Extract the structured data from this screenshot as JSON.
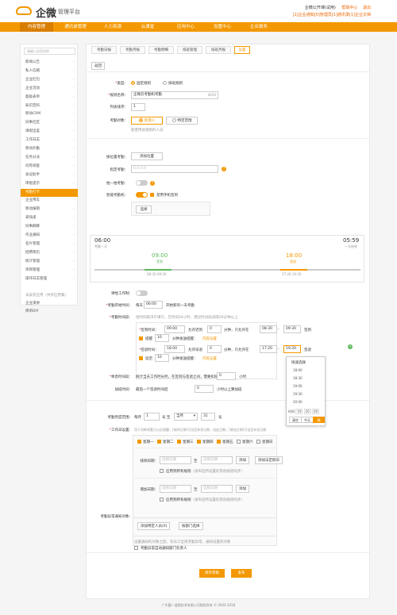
{
  "header": {
    "logo": "企微",
    "subtitle": "管理平台",
    "company": "企微公开课(试用)",
    "badge": "试用",
    "help": "帮助中心",
    "logout": "退出",
    "notice": "[1]企业通知[0]管理员[1]通讯录[1]企业文档"
  },
  "nav": [
    "内容管理",
    "通讯录管理",
    "人力资源",
    "云课堂",
    "应用中心",
    "设置中心",
    "企业服务"
  ],
  "sidebar": {
    "search_placeholder": "请输入应用名称",
    "items": [
      "新闻公告",
      "私人信箱",
      "企业红包",
      "企业活动",
      "超级表单",
      "知识百科",
      "移动CRM",
      "同事社区",
      "请假出差",
      "工作日志",
      "移动外勤",
      "任务分派",
      "问卷调查",
      "会议助手",
      "审批提示",
      "考勤打卡",
      "企业用车",
      "移动报销",
      "拿快递",
      "同事群聊",
      "作业通知",
      "名片管理",
      "招聘简历",
      "统计管理",
      "项目管理",
      "操作日志管理"
    ],
    "active_index": 15,
    "section": "未安装应用（共享应用集）",
    "extra": [
      "企业演讲",
      "简单DIY"
    ]
  },
  "tabs": [
    "考勤日报",
    "考勤月报",
    "考勤明细",
    "排班管理",
    "排班月报",
    "设置"
  ],
  "active_tab": 5,
  "back_btn": "返回",
  "form": {
    "type_label": "类型：",
    "type_fixed": "固定规则",
    "type_shift": "排班规则",
    "name_label": "规则名称：",
    "name_value": "企微云考勤机考勤",
    "name_count": "8/20",
    "order_label": "列表排序：",
    "order_value": "1",
    "target_label": "考勤对象：",
    "target_add": "新增人",
    "target_special": "特定范围",
    "target_hint": "能使用此规则的人员",
    "loc_label": "按位置考勤：",
    "loc_btn": "添加位置",
    "wifi_label": "指定考勤：",
    "wifi_ph": "0.0.0.0",
    "scan_label": "拍一拍考勤：",
    "machine_label": "智能考勤机：",
    "machine_check": "禁用手机签到",
    "select_btn": "选择"
  },
  "timeline": {
    "start": "06:00",
    "start_sub": "考勤一天",
    "end": "05:59",
    "end_sub": "一天结束",
    "t1": "09:00",
    "t1_sub": "签到",
    "t2": "18:00",
    "t2_sub": "签退",
    "r1": "08:30-09:30",
    "r2": "17:20-19:20"
  },
  "shift": {
    "flex_label": "弹性工作制：",
    "start_label": "考勤开始时间：",
    "start_pre": "每天",
    "start_val": "06:00",
    "start_post": "开始新的一天考勤",
    "time_label": "考勤时间段：",
    "time_hint": "指时间取决于填写，在时间24小时，建议时间段间隔30分钟以上",
    "in_label": "签到时间：",
    "in_time": "09:00",
    "late": "允许迟到",
    "late_v": "0",
    "late_unit": "分钟，只允许在",
    "in_from": "08:30",
    "in_to": "09:30",
    "in_act": "签到",
    "remind": "提醒",
    "remind_v": "10",
    "remind_unit": "分钟发送提醒：",
    "remind_set": "内容设置",
    "out_label": "签退时间：",
    "out_time": "18:00",
    "early": "允许早退",
    "early_v": "0",
    "out_from": "17:20",
    "out_to": "19:20",
    "out_act": "签退",
    "delay": "延迟",
    "delay_v": "10",
    "rest_label": "休息时间段：",
    "rest_text": "统计当天工作时长时，在签到与签退之间，需要扣除",
    "rest_v": "0",
    "rest_unit": "小时",
    "ot_label": "加班时间：",
    "ot_text": "最后一个签退时间后",
    "ot_v": "0",
    "ot_unit": "小时以上算加班"
  },
  "picker": {
    "title": "快速选择",
    "items": [
      "18:00",
      "18:30",
      "19:00",
      "19:30",
      "20:00"
    ],
    "label": "时间",
    "h": "19",
    "m": "20",
    "s": "00",
    "clear": "清空",
    "now": "今天",
    "ok": "确定"
  },
  "month": {
    "label": "考勤月度范围：",
    "pre": "每月",
    "d1": "1",
    "mid": "号 至",
    "sel": "当月",
    "d2": "31",
    "post": "号"
  },
  "workday": {
    "label": "工作日设置：",
    "hint": "用于判断考勤日以反提醒，[排除日期]可设定休息日期，由此日期，[增加日期]可设定补班日期",
    "days": [
      "星期一",
      "星期二",
      "星期三",
      "星期四",
      "星期五",
      "星期六",
      "星期日"
    ],
    "checked": [
      true,
      true,
      true,
      true,
      true,
      false,
      false
    ],
    "ex_label": "排除日期：",
    "ex_ph": "选择日期",
    "to": "至",
    "add": "添加",
    "add_holiday": "添加法定假日",
    "apply": "应用到所有规则",
    "apply_hint": "（发布后所设置的其他规则同步）",
    "inc_label": "增加日期："
  },
  "notify": {
    "label": "考勤异常通知对象：",
    "btn1": "添加特定人员(0)",
    "btn2": "按部门选择",
    "hint": "设置通知的对象之后，有员工出现考勤异常，通知设置的对象",
    "chk": "考勤异常自动通知部门负责人"
  },
  "actions": {
    "save": "保存草稿",
    "publish": "发布"
  },
  "footer": "广东圆一道图技术有限公司版权所有 © 2004-2018"
}
